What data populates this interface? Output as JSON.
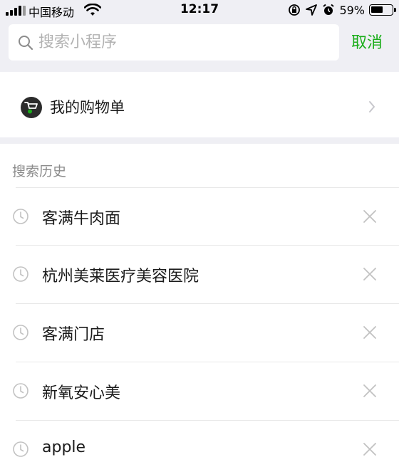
{
  "status_bar": {
    "carrier": "中国移动",
    "time": "12:17",
    "battery_percent": "59%",
    "battery_level": 0.59
  },
  "search": {
    "placeholder": "搜索小程序",
    "cancel_label": "取消"
  },
  "shopping_list": {
    "label": "我的购物单"
  },
  "history": {
    "header": "搜索历史",
    "items": [
      {
        "label": "客满牛肉面"
      },
      {
        "label": "杭州美莱医疗美容医院"
      },
      {
        "label": "客满门店"
      },
      {
        "label": "新氧安心美"
      },
      {
        "label": "apple"
      }
    ]
  },
  "colors": {
    "accent_green": "#1aad19",
    "page_bg": "#efeff4"
  }
}
